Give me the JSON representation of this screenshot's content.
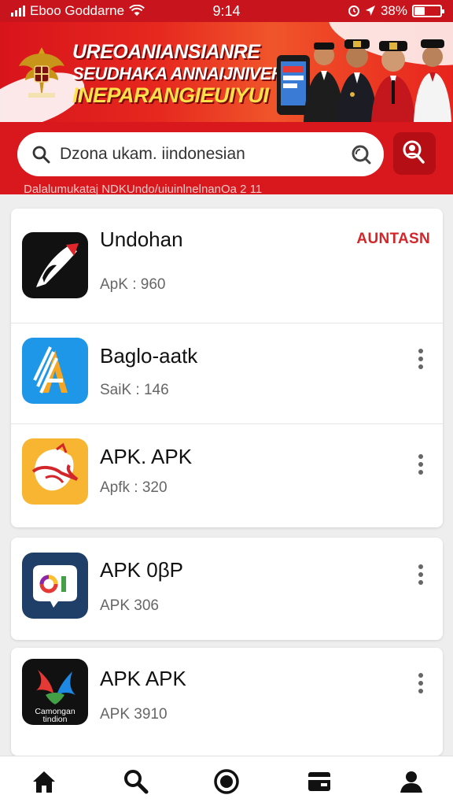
{
  "status_bar": {
    "carrier": "Eboo Goddarne",
    "time": "9:14",
    "battery": "38%",
    "battery_level": 0.38
  },
  "banner": {
    "line1": "UREOANIANSIANRE",
    "line2": "SEUDHAKA ANNAIJNIVEH.",
    "line3": "INEPARANGIEUIYUI"
  },
  "search": {
    "value": "Dzona ukam. iindonesian",
    "ticker": "Dalalumukataj NDKUndo/uiuinlnelnanOa 2 11"
  },
  "apps": [
    {
      "name": "Undohan",
      "sub": "ApK : 960",
      "badge": "AUNTASN",
      "icon": "feather-logo-icon",
      "icon_bg": "#111111"
    },
    {
      "name": "Baglo-aatk",
      "sub": "SaiK : 146",
      "icon": "striped-a-logo-icon",
      "icon_bg": "#1e97e8"
    },
    {
      "name": "APK. APK",
      "sub": "Apfk : 320",
      "icon": "shield-mask-logo-icon",
      "icon_bg": "#f7b531"
    },
    {
      "name": "APK 0βP",
      "sub": "APK 306",
      "icon": "colorful-oi-logo-icon",
      "icon_bg": "#1f3e68"
    },
    {
      "name": "APK APK",
      "sub": "APK 3910",
      "icon": "flame-logo-icon",
      "icon_bg": "#111111",
      "icon_text": "Camongan tindion"
    }
  ],
  "bottom_nav": [
    "home-icon",
    "search-icon",
    "record-icon",
    "wallet-icon",
    "account-icon"
  ],
  "colors": {
    "primary_red": "#d8181d",
    "badge_red": "#d3262b",
    "banner_yellow": "#ffe14a"
  }
}
